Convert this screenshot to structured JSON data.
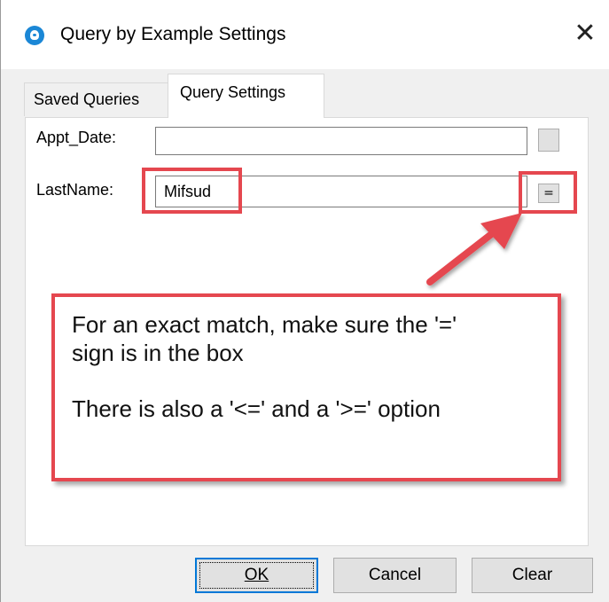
{
  "window": {
    "title": "Query by Example Settings",
    "close_glyph": "✕",
    "app_icon": "app-logo-icon"
  },
  "tabs": [
    {
      "label": "Saved Queries",
      "active": false
    },
    {
      "label": "Query Settings",
      "active": true
    }
  ],
  "fields": {
    "appt_date": {
      "label": "Appt_Date:",
      "value": "",
      "operator": ""
    },
    "last_name": {
      "label": "LastName:",
      "value": "Mifsud",
      "operator": "="
    }
  },
  "callout": {
    "line1": "For an exact match, make sure the '='",
    "line2": "sign is in the box",
    "line3": "There is also a '<=' and a '>=' option"
  },
  "buttons": {
    "ok": "OK",
    "cancel": "Cancel",
    "clear": "Clear"
  },
  "colors": {
    "highlight": "#e5474f",
    "accent": "#0078d7",
    "app_icon": "#1b87d6"
  }
}
